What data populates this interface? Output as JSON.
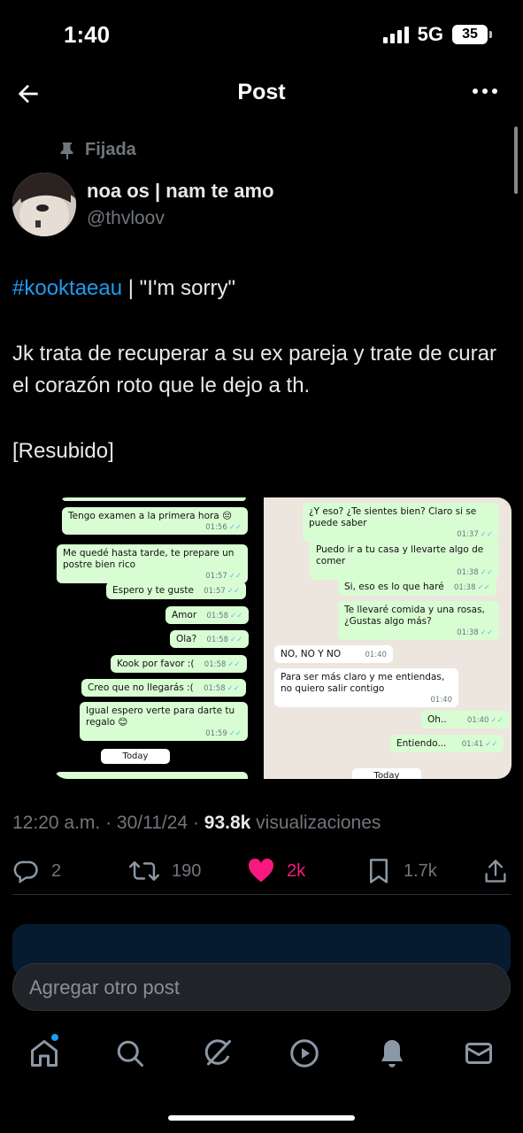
{
  "status_bar": {
    "time": "1:40",
    "network": "5G",
    "battery": "35"
  },
  "header": {
    "title": "Post"
  },
  "pinned": {
    "label": "Fijada"
  },
  "author": {
    "name": "noa os | nam te amo",
    "handle": "@thvloov"
  },
  "post": {
    "hashtag": "#kooktaeau",
    "title_rest": " | \"I'm sorry\"",
    "body": "Jk trata de recuperar a su ex pareja y trate de curar el corazón roto que le dejo a th.",
    "note": "[Resubido]"
  },
  "chat_left": [
    {
      "text": "Tengo examen a la primera hora 😔",
      "time": "01:56"
    },
    {
      "text": "Me quedé hasta tarde, te prepare un postre bien rico",
      "time": "01:57"
    },
    {
      "text": "Espero y te guste",
      "time": "01:57"
    },
    {
      "text": "Amor",
      "time": "01:58"
    },
    {
      "text": "Ola?",
      "time": "01:58"
    },
    {
      "text": "Kook por favor :(",
      "time": "01:58"
    },
    {
      "text": "Creo que no llegarás :(",
      "time": "01:58"
    },
    {
      "text": "Igual espero verte para darte tu regalo 😊",
      "time": "01:59"
    }
  ],
  "chat_left_day": "Today",
  "chat_right": [
    {
      "text": "¿Y eso? ¿Te sientes bien? Claro si se puede saber",
      "time": "01:37",
      "dir": "out"
    },
    {
      "text": "Puedo ir a tu casa y llevarte algo de comer",
      "time": "01:38",
      "dir": "out"
    },
    {
      "text": "Si, eso es lo que haré",
      "time": "01:38",
      "dir": "out"
    },
    {
      "text": "Te llevaré comida y una rosas, ¿Gustas algo más?",
      "time": "01:38",
      "dir": "out"
    },
    {
      "text": "NO, NO Y NO",
      "time": "01:40",
      "dir": "in"
    },
    {
      "text": "Para ser más claro y me entiendas, no quiero salir contigo",
      "time": "01:40",
      "dir": "in"
    },
    {
      "text": "Oh..",
      "time": "01:40",
      "dir": "out"
    },
    {
      "text": "Entiendo...",
      "time": "01:41",
      "dir": "out"
    }
  ],
  "chat_right_day": "Today",
  "meta": {
    "time": "12:20 a.m.",
    "date": "30/11/24",
    "views": "93.8k",
    "views_label": "visualizaciones"
  },
  "actions": {
    "replies": "2",
    "reposts": "190",
    "likes": "2k",
    "bookmarks": "1.7k"
  },
  "reply_box": {
    "placeholder": "Agregar otro post"
  },
  "colors": {
    "accent": "#1d9bf0",
    "like": "#f91880",
    "whatsapp_out": "#d9fdd3",
    "background": "#000000"
  },
  "icons": {
    "back": "arrow-left-icon",
    "more": "more-horizontal-icon",
    "pin": "pin-icon",
    "reply": "reply-icon",
    "repost": "repost-icon",
    "like": "heart-icon",
    "bookmark": "bookmark-icon",
    "share": "share-icon",
    "nav": [
      "home-icon",
      "search-icon",
      "grok-icon",
      "video-icon",
      "notifications-icon",
      "messages-icon"
    ]
  }
}
